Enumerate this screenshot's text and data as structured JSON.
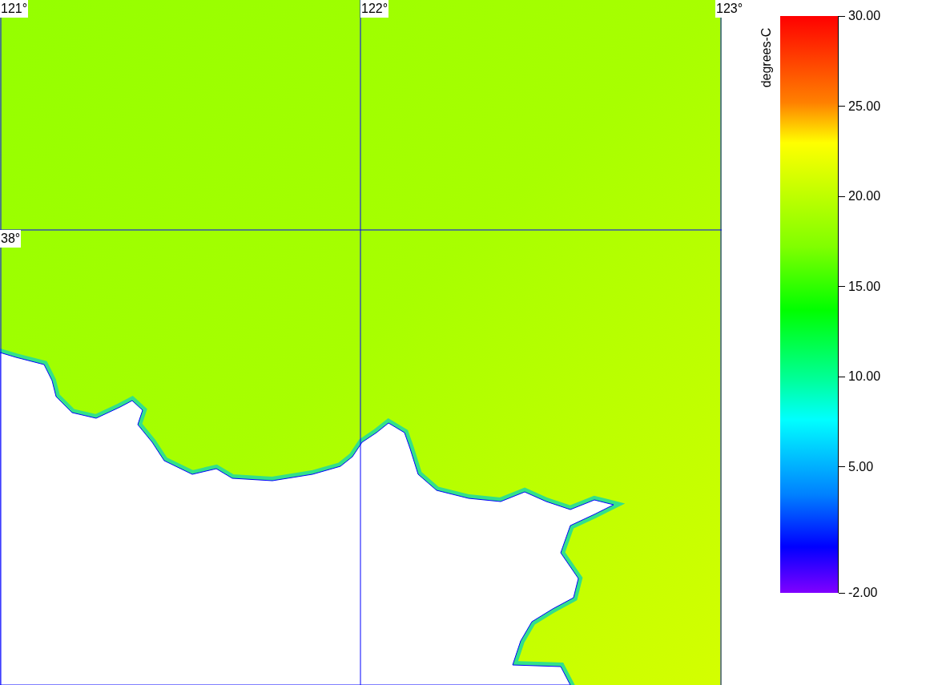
{
  "map": {
    "longitude_labels": [
      "121°",
      "122°",
      "123°"
    ],
    "latitude_labels": [
      "38°"
    ]
  },
  "colorbar": {
    "unit_label": "degrees-C",
    "ticks": [
      "30.00",
      "25.00",
      "20.00",
      "15.00",
      "10.00",
      "5.00",
      "-2.00"
    ]
  }
}
